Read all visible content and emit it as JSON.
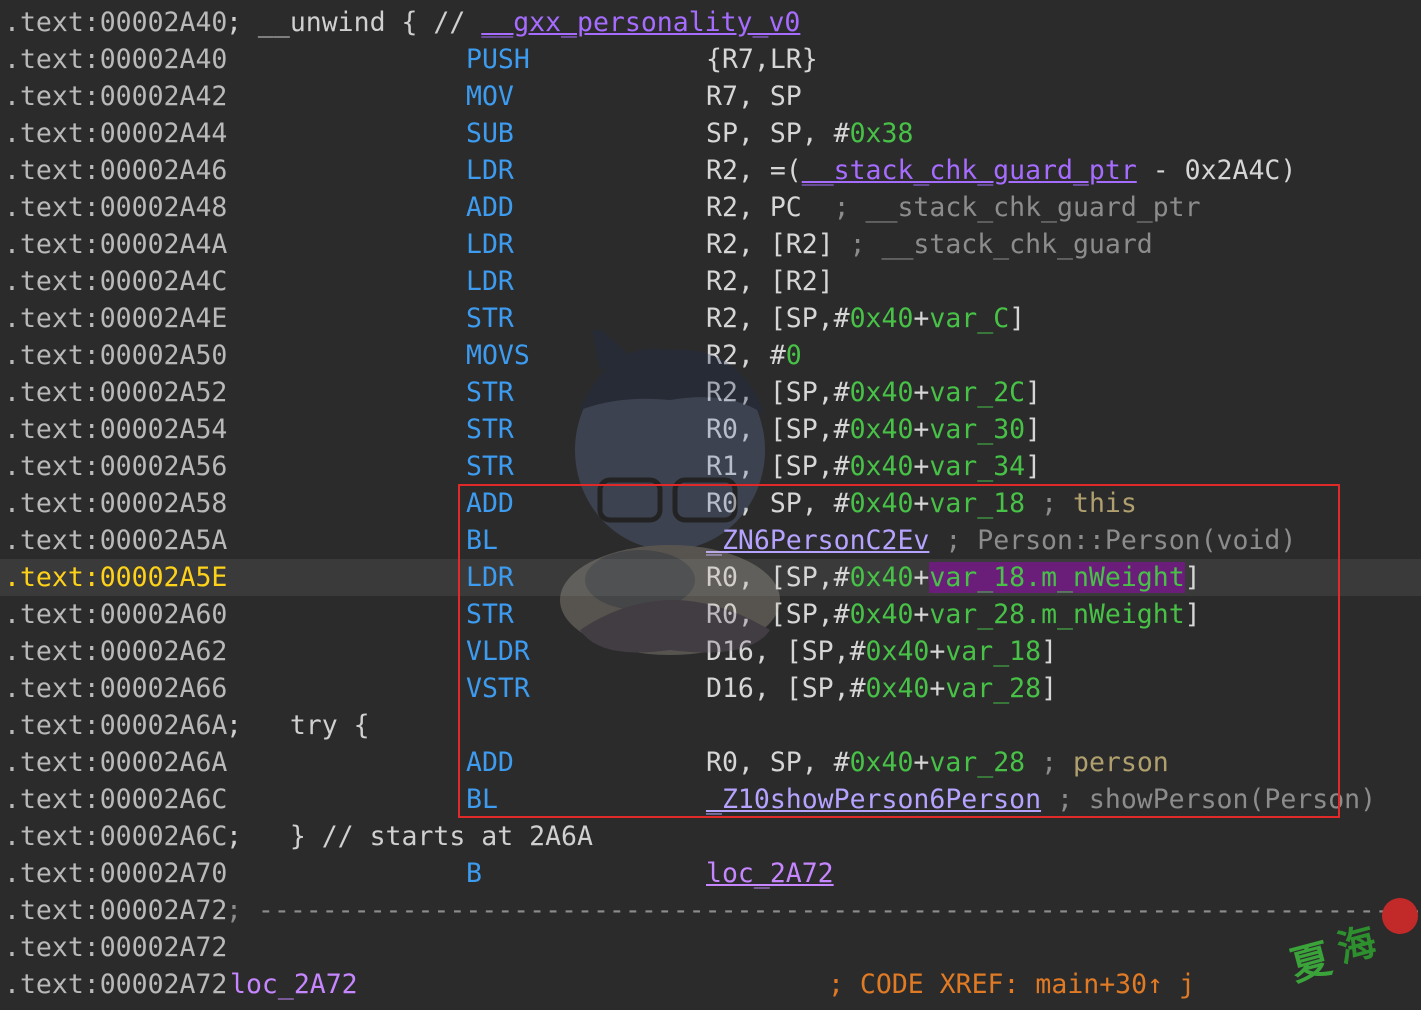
{
  "lines": [
    {
      "addr": ".text:00002A40",
      "parts": [
        {
          "cls": "cmt-left",
          "spans": [
            {
              "t": "; __unwind { // ",
              "c": "c-white"
            },
            {
              "t": "__gxx_personality_v0",
              "c": "c-sym under"
            }
          ]
        }
      ]
    },
    {
      "addr": ".text:00002A40",
      "mn": "PUSH",
      "op": [
        {
          "t": "{R7,LR}",
          "c": "c-reg"
        }
      ]
    },
    {
      "addr": ".text:00002A42",
      "mn": "MOV",
      "op": [
        {
          "t": "R7, SP",
          "c": "c-reg"
        }
      ]
    },
    {
      "addr": ".text:00002A44",
      "mn": "SUB",
      "op": [
        {
          "t": "SP, SP, #",
          "c": "c-reg"
        },
        {
          "t": "0x38",
          "c": "c-num"
        }
      ]
    },
    {
      "addr": ".text:00002A46",
      "mn": "LDR",
      "op": [
        {
          "t": "R2, =(",
          "c": "c-reg"
        },
        {
          "t": "__stack_chk_guard_ptr",
          "c": "c-sym under"
        },
        {
          "t": " - 0x2A4C)",
          "c": "c-reg"
        }
      ]
    },
    {
      "addr": ".text:00002A48",
      "mn": "ADD",
      "op": [
        {
          "t": "R2, PC  ",
          "c": "c-reg"
        },
        {
          "t": "; __stack_chk_guard_ptr",
          "c": "c-cmt"
        }
      ]
    },
    {
      "addr": ".text:00002A4A",
      "mn": "LDR",
      "op": [
        {
          "t": "R2, [R2] ",
          "c": "c-reg"
        },
        {
          "t": "; __stack_chk_guard",
          "c": "c-cmt"
        }
      ]
    },
    {
      "addr": ".text:00002A4C",
      "mn": "LDR",
      "op": [
        {
          "t": "R2, [R2]",
          "c": "c-reg"
        }
      ]
    },
    {
      "addr": ".text:00002A4E",
      "mn": "STR",
      "op": [
        {
          "t": "R2, [SP,#",
          "c": "c-reg"
        },
        {
          "t": "0x40",
          "c": "c-num"
        },
        {
          "t": "+",
          "c": "c-reg"
        },
        {
          "t": "var_C",
          "c": "c-var"
        },
        {
          "t": "]",
          "c": "c-reg"
        }
      ]
    },
    {
      "addr": ".text:00002A50",
      "mn": "MOVS",
      "op": [
        {
          "t": "R2, #",
          "c": "c-reg"
        },
        {
          "t": "0",
          "c": "c-num"
        }
      ]
    },
    {
      "addr": ".text:00002A52",
      "mn": "STR",
      "op": [
        {
          "t": "R2, [SP,#",
          "c": "c-reg"
        },
        {
          "t": "0x40",
          "c": "c-num"
        },
        {
          "t": "+",
          "c": "c-reg"
        },
        {
          "t": "var_2C",
          "c": "c-var"
        },
        {
          "t": "]",
          "c": "c-reg"
        }
      ]
    },
    {
      "addr": ".text:00002A54",
      "mn": "STR",
      "op": [
        {
          "t": "R0, [SP,#",
          "c": "c-reg"
        },
        {
          "t": "0x40",
          "c": "c-num"
        },
        {
          "t": "+",
          "c": "c-reg"
        },
        {
          "t": "var_30",
          "c": "c-var"
        },
        {
          "t": "]",
          "c": "c-reg"
        }
      ]
    },
    {
      "addr": ".text:00002A56",
      "mn": "STR",
      "op": [
        {
          "t": "R1, [SP,#",
          "c": "c-reg"
        },
        {
          "t": "0x40",
          "c": "c-num"
        },
        {
          "t": "+",
          "c": "c-reg"
        },
        {
          "t": "var_34",
          "c": "c-var"
        },
        {
          "t": "]",
          "c": "c-reg"
        }
      ]
    },
    {
      "addr": ".text:00002A58",
      "mn": "ADD",
      "op": [
        {
          "t": "R0, SP, #",
          "c": "c-reg"
        },
        {
          "t": "0x40",
          "c": "c-num"
        },
        {
          "t": "+",
          "c": "c-reg"
        },
        {
          "t": "var_18",
          "c": "c-var"
        },
        {
          "t": " ; ",
          "c": "c-cmt"
        },
        {
          "t": "this",
          "c": "c-ckw"
        }
      ]
    },
    {
      "addr": ".text:00002A5A",
      "mn": "BL",
      "op": [
        {
          "t": "_ZN6PersonC2Ev",
          "c": "c-ext under"
        },
        {
          "t": " ; Person::Person(void)",
          "c": "c-cmt"
        }
      ]
    },
    {
      "addr": ".text:00002A5E",
      "current": true,
      "mn": "LDR",
      "op": [
        {
          "t": "R0, [SP,#",
          "c": "c-reg"
        },
        {
          "t": "0x40",
          "c": "c-num"
        },
        {
          "t": "+",
          "c": "c-reg"
        },
        {
          "t": "var_18.m_nWeight",
          "c": "c-var hl-purple"
        },
        {
          "t": "]",
          "c": "c-reg"
        }
      ]
    },
    {
      "addr": ".text:00002A60",
      "mn": "STR",
      "op": [
        {
          "t": "R0, [SP,#",
          "c": "c-reg"
        },
        {
          "t": "0x40",
          "c": "c-num"
        },
        {
          "t": "+",
          "c": "c-reg"
        },
        {
          "t": "var_28.m_nWeight",
          "c": "c-var"
        },
        {
          "t": "]",
          "c": "c-reg"
        }
      ]
    },
    {
      "addr": ".text:00002A62",
      "mn": "VLDR",
      "op": [
        {
          "t": "D16, [SP,#",
          "c": "c-reg"
        },
        {
          "t": "0x40",
          "c": "c-num"
        },
        {
          "t": "+",
          "c": "c-reg"
        },
        {
          "t": "var_18",
          "c": "c-var"
        },
        {
          "t": "]",
          "c": "c-reg"
        }
      ]
    },
    {
      "addr": ".text:00002A66",
      "mn": "VSTR",
      "op": [
        {
          "t": "D16, [SP,#",
          "c": "c-reg"
        },
        {
          "t": "0x40",
          "c": "c-num"
        },
        {
          "t": "+",
          "c": "c-reg"
        },
        {
          "t": "var_28",
          "c": "c-var"
        },
        {
          "t": "]",
          "c": "c-reg"
        }
      ]
    },
    {
      "addr": ".text:00002A6A",
      "parts": [
        {
          "cls": "cmt-left",
          "spans": [
            {
              "t": ";   try {",
              "c": "c-white"
            }
          ]
        }
      ]
    },
    {
      "addr": ".text:00002A6A",
      "mn": "ADD",
      "op": [
        {
          "t": "R0, SP, #",
          "c": "c-reg"
        },
        {
          "t": "0x40",
          "c": "c-num"
        },
        {
          "t": "+",
          "c": "c-reg"
        },
        {
          "t": "var_28",
          "c": "c-var"
        },
        {
          "t": " ; ",
          "c": "c-cmt"
        },
        {
          "t": "person",
          "c": "c-ckw"
        }
      ]
    },
    {
      "addr": ".text:00002A6C",
      "mn": "BL",
      "op": [
        {
          "t": "_Z10showPerson6Person",
          "c": "c-ext under"
        },
        {
          "t": " ; showPerson(Person)",
          "c": "c-cmt"
        }
      ]
    },
    {
      "addr": ".text:00002A6C",
      "parts": [
        {
          "cls": "cmt-left",
          "spans": [
            {
              "t": ";   } // starts at 2A6A",
              "c": "c-white"
            }
          ]
        }
      ]
    },
    {
      "addr": ".text:00002A70",
      "mn": "B",
      "op": [
        {
          "t": "loc_2A72",
          "c": "c-loc under"
        }
      ]
    },
    {
      "addr": ".text:00002A72",
      "parts": [
        {
          "cls": "cmt-left",
          "spans": [
            {
              "t": "; ---------------------------------------------------------------------------",
              "c": "c-cmt"
            }
          ]
        }
      ]
    },
    {
      "addr": ".text:00002A72"
    },
    {
      "addr": ".text:00002A72",
      "parts": [
        {
          "cls": "lbl",
          "spans": [
            {
              "t": "loc_2A72",
              "c": "c-loc"
            }
          ]
        },
        {
          "cls": "xref",
          "spans": [
            {
              "t": "; CODE XREF: main+30↑ j",
              "c": "c-xref"
            }
          ]
        }
      ]
    }
  ],
  "watermark": {
    "stamp_text": "夏海"
  },
  "colors": {
    "background": "#2b2b2b",
    "mnemonic": "#3d9cf0",
    "number": "#47c247",
    "symbol": "#a66cff",
    "current_address": "#ffd21a",
    "selection_box": "#e02a2a",
    "xref": "#e07a24"
  }
}
